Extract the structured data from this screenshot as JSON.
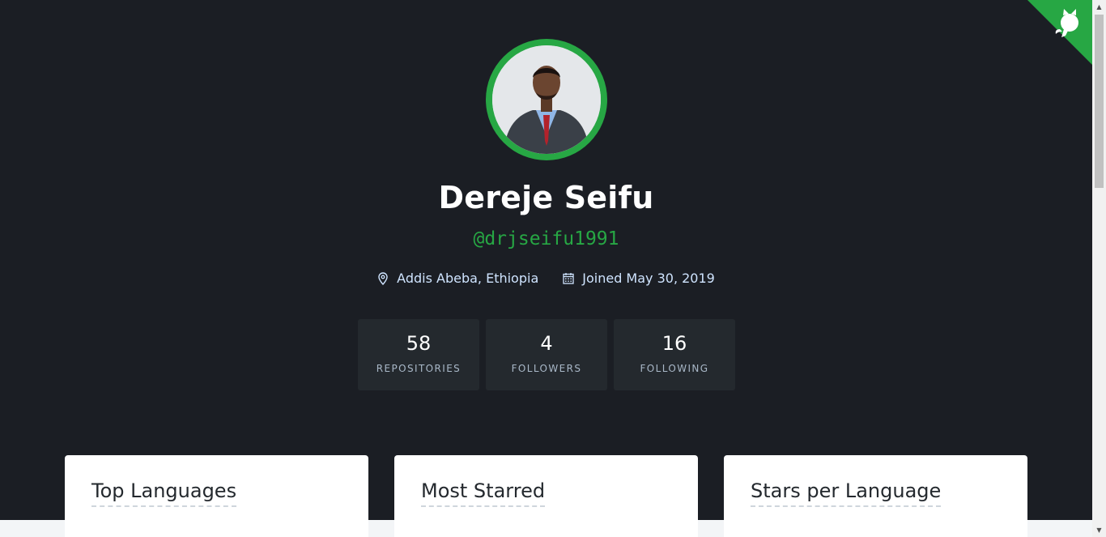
{
  "profile": {
    "name": "Dereje Seifu",
    "handle": "@drjseifu1991",
    "location": "Addis Abeba, Ethiopia",
    "joined": "Joined May 30, 2019"
  },
  "stats": [
    {
      "value": "58",
      "label": "REPOSITORIES"
    },
    {
      "value": "4",
      "label": "FOLLOWERS"
    },
    {
      "value": "16",
      "label": "FOLLOWING"
    }
  ],
  "cards": [
    {
      "title": "Top Languages"
    },
    {
      "title": "Most Starred"
    },
    {
      "title": "Stars per Language"
    }
  ],
  "colors": {
    "background": "#1b1e24",
    "accent_green": "#27a744",
    "stat_box": "#24292e",
    "meta_text": "#cfe4ff"
  },
  "icons": {
    "corner": "octocat-icon",
    "location": "map-pin-icon",
    "calendar": "calendar-icon"
  }
}
